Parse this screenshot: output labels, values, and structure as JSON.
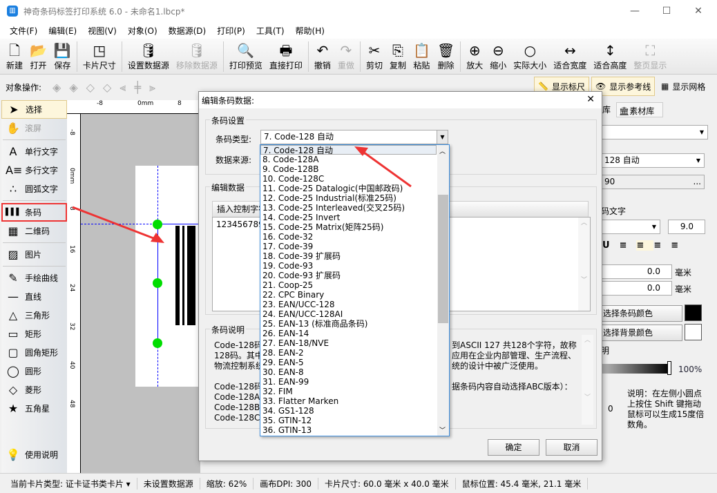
{
  "window": {
    "title": "神奇条码标签打印系统 6.0 - 未命名1.lbcp*",
    "minimize": "—",
    "maximize": "☐",
    "close": "✕"
  },
  "menu": [
    "文件(F)",
    "编辑(E)",
    "视图(V)",
    "对象(O)",
    "数据源(D)",
    "打印(P)",
    "工具(T)",
    "帮助(H)"
  ],
  "toolbar": [
    {
      "label": "新建",
      "icon": "new-file-icon",
      "glyph": "🗋",
      "enabled": true
    },
    {
      "label": "打开",
      "icon": "open-icon",
      "glyph": "📂",
      "enabled": true
    },
    {
      "label": "保存",
      "icon": "save-icon",
      "glyph": "💾",
      "enabled": true
    },
    {
      "label": "卡片尺寸",
      "icon": "card-size-icon",
      "glyph": "◳",
      "enabled": true
    },
    {
      "label": "设置数据源",
      "icon": "database-icon",
      "glyph": "🛢",
      "enabled": true
    },
    {
      "label": "移除数据源",
      "icon": "remove-database-icon",
      "glyph": "🛢",
      "enabled": false
    },
    {
      "label": "打印预览",
      "icon": "print-preview-icon",
      "glyph": "🔍",
      "enabled": true
    },
    {
      "label": "直接打印",
      "icon": "printer-icon",
      "glyph": "🖶",
      "enabled": true
    },
    {
      "label": "撤销",
      "icon": "undo-icon",
      "glyph": "↶",
      "enabled": true
    },
    {
      "label": "重做",
      "icon": "redo-icon",
      "glyph": "↷",
      "enabled": false
    },
    {
      "label": "剪切",
      "icon": "cut-icon",
      "glyph": "✂",
      "enabled": true
    },
    {
      "label": "复制",
      "icon": "copy-icon",
      "glyph": "⎘",
      "enabled": true
    },
    {
      "label": "粘贴",
      "icon": "paste-icon",
      "glyph": "📋",
      "enabled": true
    },
    {
      "label": "删除",
      "icon": "trash-icon",
      "glyph": "🗑",
      "enabled": true
    },
    {
      "label": "放大",
      "icon": "zoom-in-icon",
      "glyph": "⊕",
      "enabled": true
    },
    {
      "label": "缩小",
      "icon": "zoom-out-icon",
      "glyph": "⊖",
      "enabled": true
    },
    {
      "label": "实际大小",
      "icon": "actual-size-icon",
      "glyph": "○",
      "enabled": true
    },
    {
      "label": "适合宽度",
      "icon": "fit-width-icon",
      "glyph": "↔",
      "enabled": true
    },
    {
      "label": "适合高度",
      "icon": "fit-height-icon",
      "glyph": "↕",
      "enabled": true
    },
    {
      "label": "整页显示",
      "icon": "fit-page-icon",
      "glyph": "⛶",
      "enabled": false
    }
  ],
  "objbar": {
    "label": "对象操作:"
  },
  "view_toggles": {
    "ruler": "显示标尺",
    "guides": "显示参考线",
    "grid": "显示网格"
  },
  "toolbox": [
    "选择",
    "滚屏",
    "单行文字",
    "多行文字",
    "圆弧文字",
    "条码",
    "二维码",
    "图片",
    "手绘曲线",
    "直线",
    "三角形",
    "矩形",
    "圆角矩形",
    "圆形",
    "菱形",
    "五角星",
    "使用说明"
  ],
  "rulers": {
    "h": [
      "-8",
      "0mm",
      "8"
    ],
    "v": [
      "-8",
      "0mm",
      "8",
      "16",
      "24",
      "32",
      "40",
      "48"
    ]
  },
  "right_panel": {
    "tab_partial": "库",
    "tab_material": "素材库",
    "type_value": "128 自动",
    "data_value": "90",
    "text_label": "码文字",
    "font_size": "9.0",
    "offset1": "0.0",
    "offset2": "0.0",
    "unit": "毫米",
    "barcode_color_btn": "选择条码颜色",
    "bg_color_btn": "选择背景颜色",
    "opacity_label": "明",
    "opacity": "100%",
    "angle": "0",
    "hint": "说明：在左侧小圆点上按住 Shift 键拖动鼠标可以生成15度倍数角。",
    "barcode_color": "#000000",
    "bg_color": "#ffffff"
  },
  "dialog": {
    "title": "编辑条码数据:",
    "group_settings": "条码设置",
    "type_label": "条码类型:",
    "type_value": "7.  Code-128 自动",
    "source_label": "数据来源:",
    "group_data": "编辑数据",
    "insert_ctrl": "插入控制字符",
    "data_value": "123456789",
    "group_desc": "条码说明",
    "desc_lines": [
      "Code-128码是",
      "128码。其中",
      "物流控制系统",
      "",
      "Code-128码有",
      "Code-128A:",
      "Code-128B:",
      "Code-128C:"
    ],
    "desc_right": [
      "到ASCII 127 共128个字符，故称",
      "应用在企业内部管理、生产流程、",
      "统的设计中被广泛使用。",
      "",
      "据条码内容自动选择ABC版本）："
    ],
    "ok": "确定",
    "cancel": "取消",
    "options": [
      "7.  Code-128 自动",
      "8.  Code-128A",
      "9.  Code-128B",
      "10.  Code-128C",
      "11.  Code-25 Datalogic(中国邮政码)",
      "12.  Code-25 Industrial(标准25码)",
      "13.  Code-25 Interleaved(交叉25码)",
      "14.  Code-25 Invert",
      "15.  Code-25 Matrix(矩阵25码)",
      "16.  Code-32",
      "17.  Code-39",
      "18.  Code-39 扩展码",
      "19.  Code-93",
      "20.  Code-93 扩展码",
      "21.  Coop-25",
      "22.  CPC Binary",
      "23.  EAN/UCC-128",
      "24.  EAN/UCC-128AI",
      "25.  EAN-13 (标准商品条码)",
      "26.  EAN-14",
      "27.  EAN-18/NVE",
      "28.  EAN-2",
      "29.  EAN-5",
      "30.  EAN-8",
      "31.  EAN-99",
      "32.  FIM",
      "33.  Flatter Marken",
      "34.  GS1-128",
      "35.  GTIN-12",
      "36.  GTIN-13"
    ],
    "scroll_fraction": 0.35
  },
  "statusbar": [
    "当前卡片类型: 证卡证书类卡片 ▾",
    "未设置数据源",
    "缩放: 62%",
    "画布DPI: 300",
    "卡片尺寸: 60.0 毫米 x 40.0 毫米",
    "鼠标位置: 45.4 毫米, 21.1 毫米"
  ],
  "accent": "#e33333"
}
